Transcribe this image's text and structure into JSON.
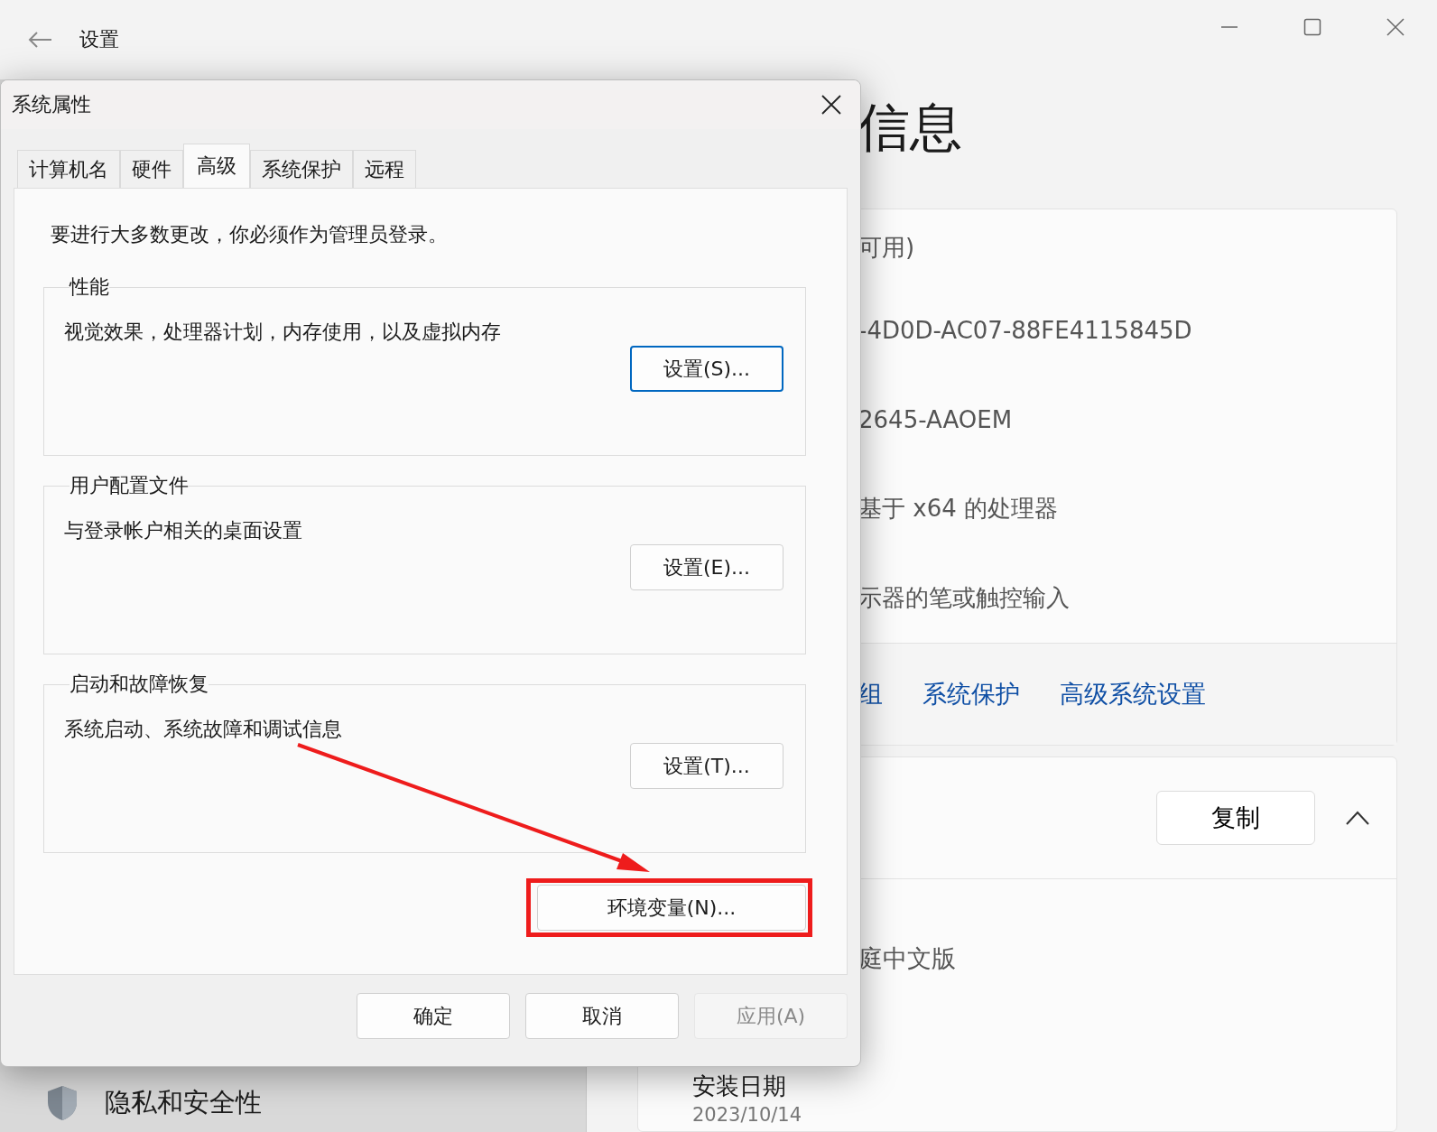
{
  "settings": {
    "title": "设置",
    "heading": "信息",
    "info_rows": [
      "可用)",
      "-4D0D-AC07-88FE4115845D",
      "2645-AAOEM",
      "基于 x64 的处理器",
      "示器的笔或触控输入"
    ],
    "related_links": [
      "组",
      "系统保护",
      "高级系统设置"
    ],
    "copy_button": "复制",
    "expanded": true,
    "edition": "庭中文版",
    "sidebar_item": "隐私和安全性",
    "install_label": "安装日期",
    "install_value": "2023/10/14"
  },
  "dialog": {
    "title": "系统属性",
    "tabs": [
      {
        "label": "计算机名",
        "selected": false
      },
      {
        "label": "硬件",
        "selected": false
      },
      {
        "label": "高级",
        "selected": true
      },
      {
        "label": "系统保护",
        "selected": false
      },
      {
        "label": "远程",
        "selected": false
      }
    ],
    "notice": "要进行大多数更改，你必须作为管理员登录。",
    "groups": [
      {
        "title": "性能",
        "description": "视觉效果，处理器计划，内存使用，以及虚拟内存",
        "button": "设置(S)...",
        "focused": true
      },
      {
        "title": "用户配置文件",
        "description": "与登录帐户相关的桌面设置",
        "button": "设置(E)...",
        "focused": false
      },
      {
        "title": "启动和故障恢复",
        "description": "系统启动、系统故障和调试信息",
        "button": "设置(T)...",
        "focused": false
      }
    ],
    "env_button": "环境变量(N)...",
    "env_highlighted": true,
    "buttons": [
      {
        "label": "确定",
        "disabled": false
      },
      {
        "label": "取消",
        "disabled": false
      },
      {
        "label": "应用(A)",
        "disabled": true
      }
    ]
  }
}
